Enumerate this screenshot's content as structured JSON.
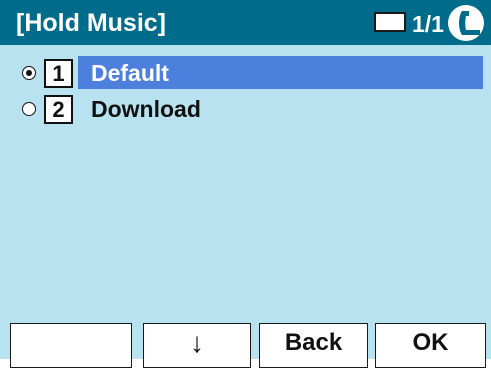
{
  "header": {
    "title": "[Hold Music]",
    "page_indicator": "1/1",
    "status_icon": "handset-icon"
  },
  "options": [
    {
      "number": "1",
      "label": "Default",
      "selected": true
    },
    {
      "number": "2",
      "label": "Download",
      "selected": false
    }
  ],
  "softkeys": {
    "key1": "",
    "key2": "↓",
    "key3": "Back",
    "key4": "OK"
  },
  "colors": {
    "title_bar": "#006b8a",
    "list_background": "#b8e2ef",
    "highlight": "#4c80dc"
  }
}
